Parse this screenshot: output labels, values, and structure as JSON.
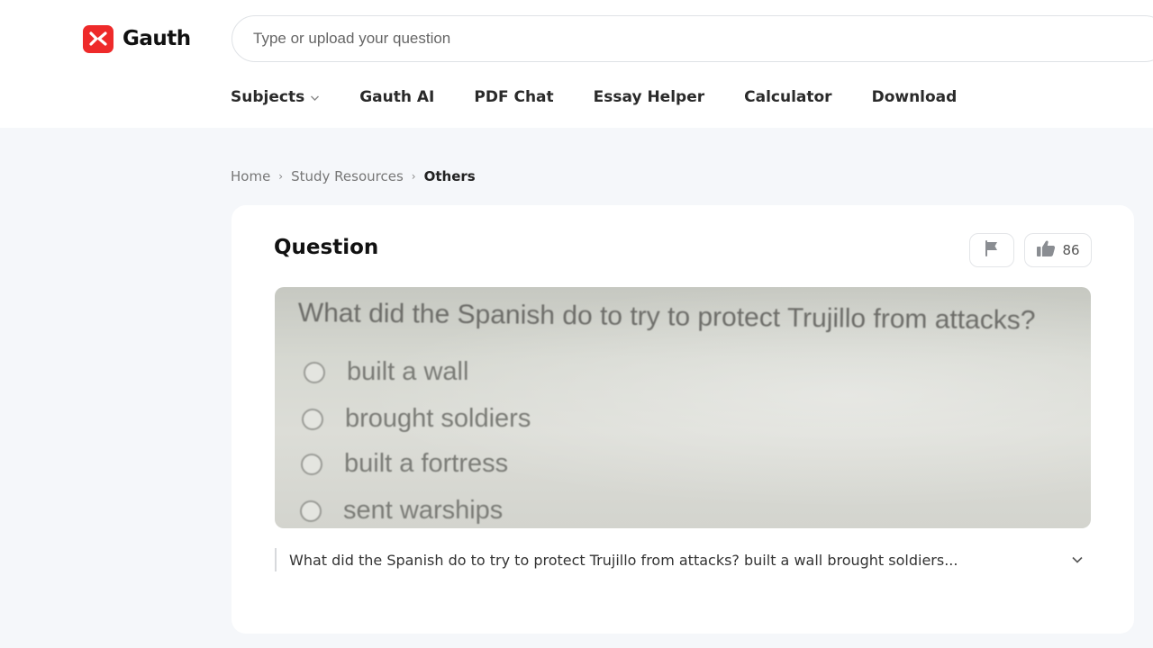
{
  "header": {
    "logo_text": "Gauth",
    "brand_color": "#ee2a2a",
    "search_placeholder": "Type or upload your question"
  },
  "nav": {
    "items": [
      {
        "label": "Subjects",
        "has_dropdown": true
      },
      {
        "label": "Gauth AI"
      },
      {
        "label": "PDF Chat"
      },
      {
        "label": "Essay Helper"
      },
      {
        "label": "Calculator"
      },
      {
        "label": "Download"
      }
    ]
  },
  "breadcrumb": {
    "home": "Home",
    "section": "Study Resources",
    "current": "Others"
  },
  "question": {
    "title": "Question",
    "like_count": "86",
    "image_question": "What did the Spanish do to try to protect Trujillo from attacks?",
    "options": [
      "built a wall",
      "brought soldiers",
      "built a fortress",
      "sent warships"
    ],
    "transcript": "What did the Spanish do to try to protect Trujillo from attacks? built a wall brought soldiers..."
  }
}
